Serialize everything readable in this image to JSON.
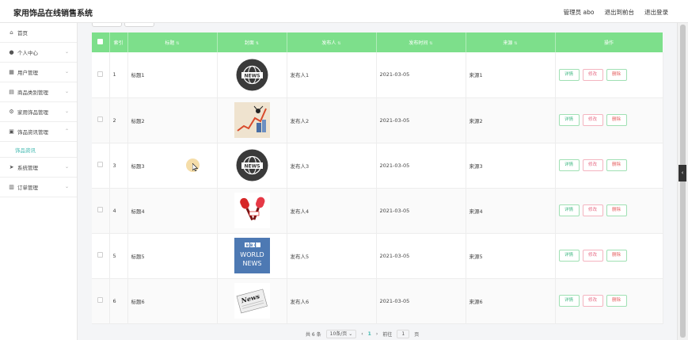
{
  "header": {
    "title": "家用饰品在线销售系统",
    "user": "管理员 abo",
    "to_front": "退出到前台",
    "logout": "退出登录"
  },
  "sidebar": {
    "items": [
      {
        "label": "首页",
        "icon": "home-icon",
        "glyph": "⌂",
        "chev": ""
      },
      {
        "label": "个人中心",
        "icon": "user-icon",
        "glyph": "●",
        "chev": "⌄"
      },
      {
        "label": "用户管理",
        "icon": "users-icon",
        "glyph": "▦",
        "chev": "⌄"
      },
      {
        "label": "商品类别管理",
        "icon": "category-icon",
        "glyph": "▤",
        "chev": "⌄"
      },
      {
        "label": "家用饰品管理",
        "icon": "gear-icon",
        "glyph": "⚙",
        "chev": "⌄"
      },
      {
        "label": "饰品资讯管理",
        "icon": "news-icon",
        "glyph": "▣",
        "chev": "⌃"
      }
    ],
    "sub_item": "饰品资讯",
    "items_after": [
      {
        "label": "系统管理",
        "icon": "send-icon",
        "glyph": "➤",
        "chev": "⌄"
      },
      {
        "label": "订单管理",
        "icon": "order-icon",
        "glyph": "▥",
        "chev": "⌄"
      }
    ]
  },
  "table": {
    "headers": [
      "索引",
      "标题",
      "封面",
      "发布人",
      "发布时间",
      "来源",
      "操作"
    ],
    "rows": [
      {
        "index": "1",
        "title": "标题1",
        "cover": "news-globe",
        "author": "发布人1",
        "date": "2021-03-05",
        "source": "来源1"
      },
      {
        "index": "2",
        "title": "标题2",
        "cover": "chart-graphic",
        "author": "发布人2",
        "date": "2021-03-05",
        "source": "来源2"
      },
      {
        "index": "3",
        "title": "标题3",
        "cover": "news-globe",
        "author": "发布人3",
        "date": "2021-03-05",
        "source": "来源3"
      },
      {
        "index": "4",
        "title": "标题4",
        "cover": "microphones",
        "author": "发布人4",
        "date": "2021-03-05",
        "source": "来源4"
      },
      {
        "index": "5",
        "title": "标题5",
        "cover": "bbc-world-news",
        "author": "发布人5",
        "date": "2021-03-05",
        "source": "来源5"
      },
      {
        "index": "6",
        "title": "标题6",
        "cover": "newspaper",
        "author": "发布人6",
        "date": "2021-03-05",
        "source": "来源6"
      }
    ],
    "actions": {
      "detail": "详情",
      "edit": "修改",
      "delete": "删除"
    }
  },
  "covers": {
    "news_text": "NEWS",
    "bbc": "BBC",
    "world": "WORLD",
    "news": "NEWS",
    "paper_text": "News"
  },
  "pagination": {
    "total": "共 6 条",
    "page_size": "10条/页",
    "prev": "‹",
    "current": "1",
    "next": "›",
    "goto": "前往",
    "goto_value": "1",
    "page_unit": "页"
  },
  "colors": {
    "header_green": "#7ddf8b",
    "accent_teal": "#3fb8af",
    "edit_pink": "#e76b85",
    "delete_red": "#e45c5c"
  }
}
